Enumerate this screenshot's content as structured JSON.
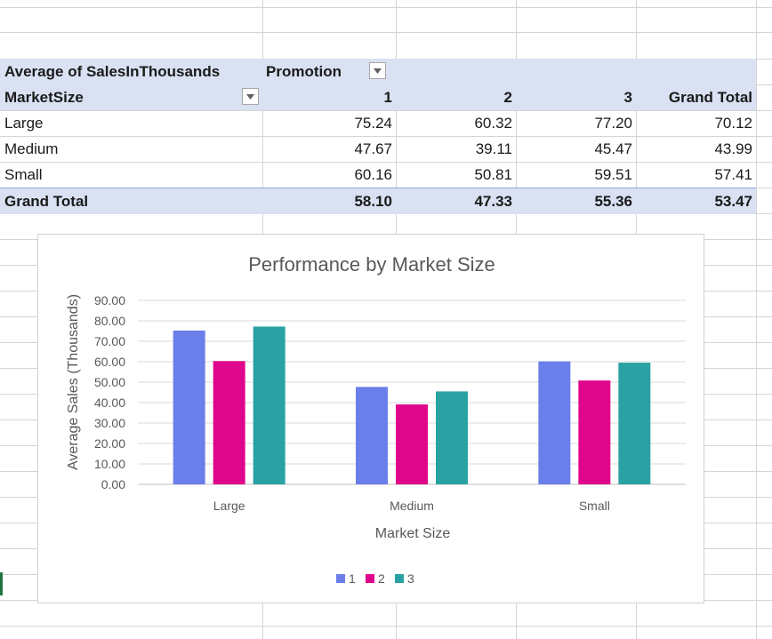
{
  "pivot": {
    "value_label": "Average of SalesInThousands",
    "column_field": "Promotion",
    "row_field": "MarketSize",
    "column_headers": [
      "1",
      "2",
      "3",
      "Grand Total"
    ],
    "rows": [
      {
        "label": "Large",
        "values": [
          "75.24",
          "60.32",
          "77.20",
          "70.12"
        ]
      },
      {
        "label": "Medium",
        "values": [
          "47.67",
          "39.11",
          "45.47",
          "43.99"
        ]
      },
      {
        "label": "Small",
        "values": [
          "60.16",
          "50.81",
          "59.51",
          "57.41"
        ]
      }
    ],
    "grand_total": {
      "label": "Grand Total",
      "values": [
        "58.10",
        "47.33",
        "55.36",
        "53.47"
      ]
    }
  },
  "chart_data": {
    "type": "bar",
    "title": "Performance by Market Size",
    "xlabel": "Market Size",
    "ylabel": "Average Sales (Thousands)",
    "categories": [
      "Large",
      "Medium",
      "Small"
    ],
    "series": [
      {
        "name": "1",
        "values": [
          75.24,
          47.67,
          60.16
        ],
        "color": "#6a7fea"
      },
      {
        "name": "2",
        "values": [
          60.32,
          39.11,
          50.81
        ],
        "color": "#e0068c"
      },
      {
        "name": "3",
        "values": [
          77.2,
          45.47,
          59.51
        ],
        "color": "#2aa1a3"
      }
    ],
    "ylim": [
      0,
      90
    ],
    "yticks": [
      "0.00",
      "10.00",
      "20.00",
      "30.00",
      "40.00",
      "50.00",
      "60.00",
      "70.00",
      "80.00",
      "90.00"
    ],
    "grid": true,
    "legend": "bottom"
  }
}
